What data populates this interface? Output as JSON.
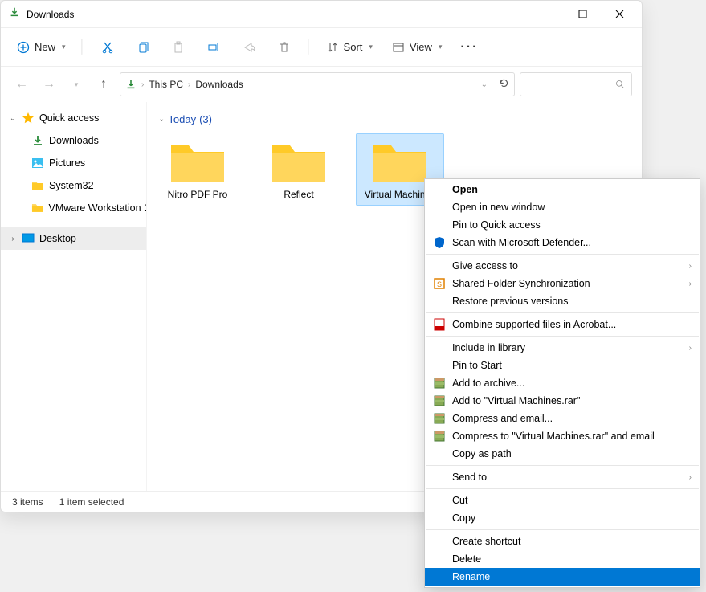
{
  "title": "Downloads",
  "toolbar": {
    "new": "New",
    "sort": "Sort",
    "view": "View"
  },
  "breadcrumb": {
    "root": "This PC",
    "current": "Downloads"
  },
  "sidebar": {
    "quick_access": "Quick access",
    "items": [
      "Downloads",
      "Pictures",
      "System32",
      "VMware Workstation 1"
    ],
    "desktop": "Desktop"
  },
  "group": {
    "label": "Today",
    "count": "(3)"
  },
  "folders": [
    "Nitro PDF Pro",
    "Reflect",
    "Virtual Machines"
  ],
  "status": {
    "items": "3 items",
    "selected": "1 item selected"
  },
  "menu": {
    "open": "Open",
    "open_new": "Open in new window",
    "pin_qa": "Pin to Quick access",
    "defender": "Scan with Microsoft Defender...",
    "give_access": "Give access to",
    "shared_sync": "Shared Folder Synchronization",
    "restore": "Restore previous versions",
    "acrobat": "Combine supported files in Acrobat...",
    "include_lib": "Include in library",
    "pin_start": "Pin to Start",
    "add_archive": "Add to archive...",
    "add_rar": "Add to \"Virtual Machines.rar\"",
    "compress_email": "Compress and email...",
    "compress_rar_email": "Compress to \"Virtual Machines.rar\" and email",
    "copy_path": "Copy as path",
    "send_to": "Send to",
    "cut": "Cut",
    "copy": "Copy",
    "create_shortcut": "Create shortcut",
    "delete": "Delete",
    "rename": "Rename"
  }
}
